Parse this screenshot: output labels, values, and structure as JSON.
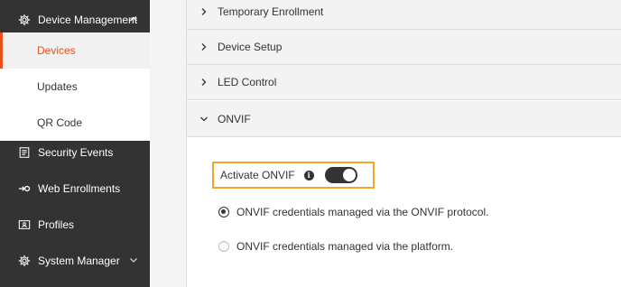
{
  "sidebar": {
    "device_management": {
      "label": "Device Management",
      "icon": "gear-icon",
      "expanded": true
    },
    "sub_items": [
      {
        "label": "Devices",
        "active": true
      },
      {
        "label": "Updates",
        "active": false
      },
      {
        "label": "QR Code",
        "active": false
      }
    ],
    "items": [
      {
        "label": "Security Events",
        "icon": "list-icon"
      },
      {
        "label": "Web Enrollments",
        "icon": "enroll-icon"
      },
      {
        "label": "Profiles",
        "icon": "profile-card-icon"
      },
      {
        "label": "System Manager",
        "icon": "gear-icon",
        "expanded": false
      }
    ]
  },
  "accordion": [
    {
      "label": "Temporary Enrollment",
      "expanded": false
    },
    {
      "label": "Device Setup",
      "expanded": false
    },
    {
      "label": "LED Control",
      "expanded": false
    },
    {
      "label": "ONVIF",
      "expanded": true
    }
  ],
  "onvif": {
    "activate_label": "Activate ONVIF",
    "info_glyph": "i",
    "activated": true,
    "options": [
      {
        "label": "ONVIF credentials managed via the ONVIF protocol.",
        "selected": true
      },
      {
        "label": "ONVIF credentials managed via the platform.",
        "selected": false
      }
    ]
  },
  "colors": {
    "sidebar_bg": "#333333",
    "accent": "#e8501c",
    "highlight_border": "#f5a623"
  }
}
